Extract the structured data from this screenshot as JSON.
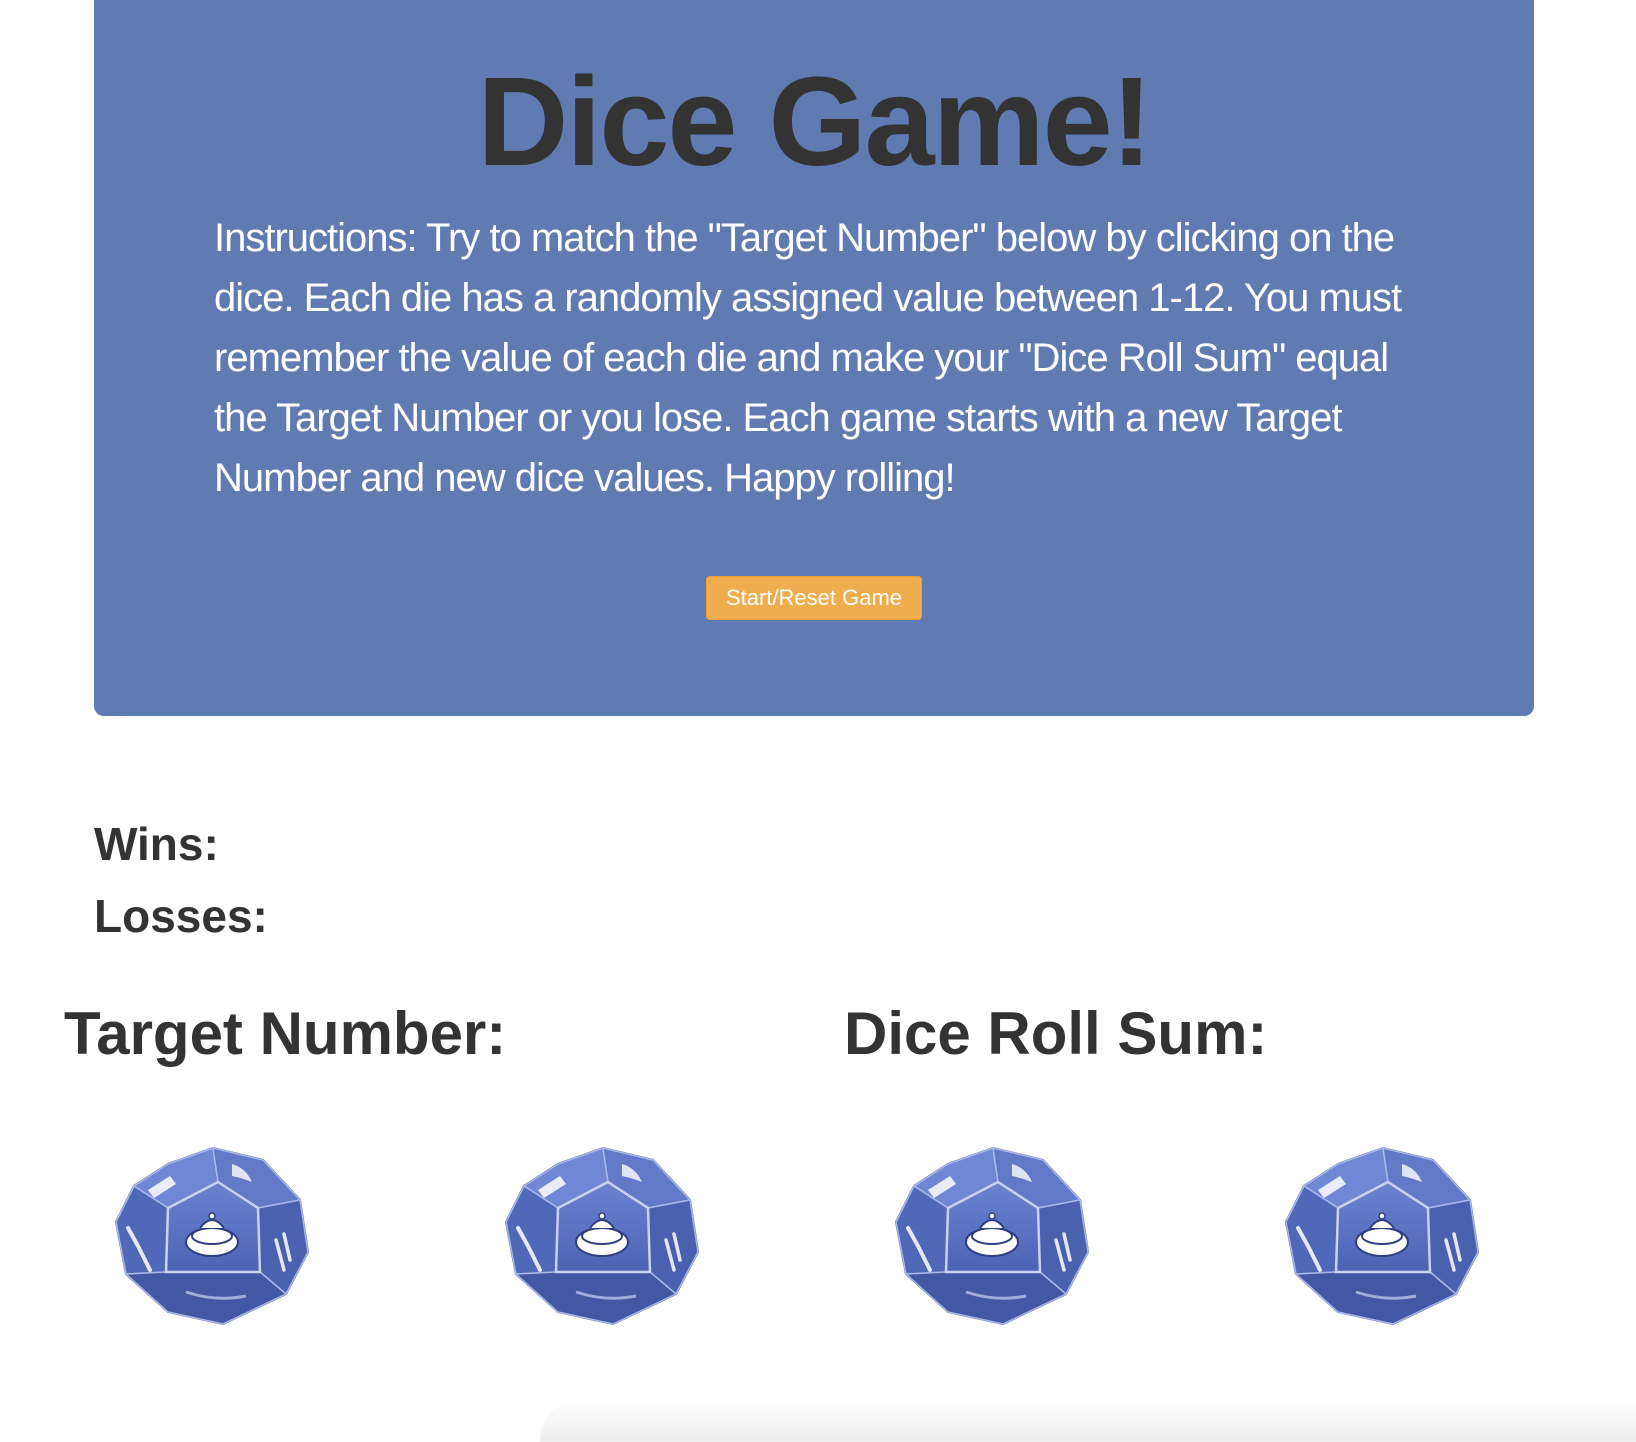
{
  "header": {
    "title": "Dice Game!",
    "instructions": "Instructions: Try to match the \"Target Number\" below by clicking on the dice. Each die has a randomly assigned value between 1-12. You must remember the value of each die and make your \"Dice Roll Sum\" equal the Target Number or you lose. Each game starts with a new Target Number and new dice values. Happy rolling!",
    "start_button_label": "Start/Reset Game"
  },
  "stats": {
    "wins_label": "Wins:",
    "wins_value": "",
    "losses_label": "Losses:",
    "losses_value": ""
  },
  "game": {
    "target_label": "Target Number:",
    "target_value": "",
    "sum_label": "Dice Roll Sum:",
    "sum_value": ""
  },
  "dice": [
    {
      "icon": "dodecahedron-die-icon"
    },
    {
      "icon": "dodecahedron-die-icon"
    },
    {
      "icon": "dodecahedron-die-icon"
    },
    {
      "icon": "dodecahedron-die-icon"
    }
  ],
  "colors": {
    "jumbotron_bg": "#5f7bb2",
    "button_bg": "#f0ad4e",
    "die_blue": "#5b73c4",
    "text_dark": "#333333"
  }
}
